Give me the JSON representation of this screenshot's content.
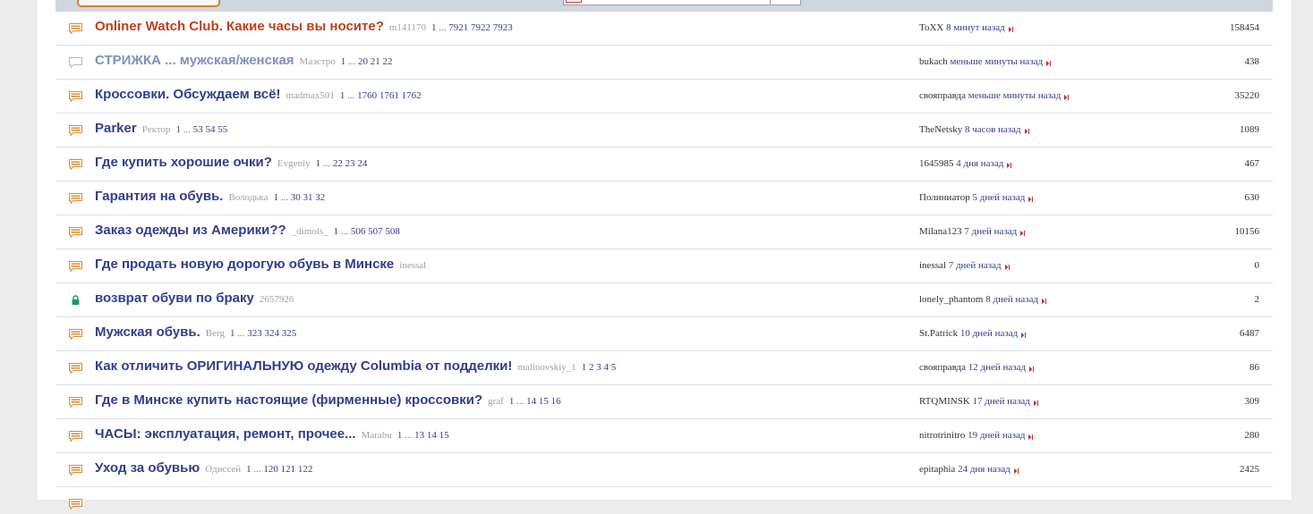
{
  "topics": [
    {
      "title": "Onliner Watch Club. Какие часы вы носите?",
      "style": "hot",
      "icon": "comment-icon",
      "author": "m141170",
      "pages": [
        "1",
        "...",
        "7921",
        "7922",
        "7923"
      ],
      "last_user": "ToXX",
      "last_time": "8 минут назад",
      "replies": "158454"
    },
    {
      "title": "СТРИЖКА ... мужская/женская",
      "style": "read",
      "icon": "comment-read-icon",
      "author": "Маэстро",
      "pages": [
        "1",
        "...",
        "20",
        "21",
        "22"
      ],
      "last_user": "bukach",
      "last_time": "меньше минуты назад",
      "replies": "438"
    },
    {
      "title": "Кроссовки. Обсуждаем всё!",
      "style": "normal",
      "icon": "comment-icon",
      "author": "madmax501",
      "pages": [
        "1",
        "...",
        "1760",
        "1761",
        "1762"
      ],
      "last_user": "свояправда",
      "last_time": "меньше минуты назад",
      "replies": "35220"
    },
    {
      "title": "Parker",
      "style": "normal",
      "icon": "comment-icon",
      "author": "Ректор",
      "pages": [
        "1",
        "...",
        "53",
        "54",
        "55"
      ],
      "last_user": "TheNetsky",
      "last_time": "8 часов назад",
      "replies": "1089"
    },
    {
      "title": "Где купить хорошие очки?",
      "style": "normal",
      "icon": "comment-icon",
      "author": "Evgeniy",
      "pages": [
        "1",
        "...",
        "22",
        "23",
        "24"
      ],
      "last_user": "1645985",
      "last_time": "4 дня назад",
      "replies": "467"
    },
    {
      "title": "Гарантия на обувь.",
      "style": "normal",
      "icon": "comment-icon",
      "author": "Володька",
      "pages": [
        "1",
        "...",
        "30",
        "31",
        "32"
      ],
      "last_user": "Полиниатор",
      "last_time": "5 дней назад",
      "replies": "630"
    },
    {
      "title": "Заказ одежды из Америки??",
      "style": "normal",
      "icon": "comment-icon",
      "author": "_dimols_",
      "pages": [
        "1",
        "...",
        "506",
        "507",
        "508"
      ],
      "last_user": "Milana123",
      "last_time": "7 дней назад",
      "replies": "10156"
    },
    {
      "title": "Где продать новую дорогую обувь в Минске",
      "style": "normal",
      "icon": "comment-icon",
      "author": "inessal",
      "pages": [],
      "last_user": "inessal",
      "last_time": "7 дней назад",
      "replies": "0"
    },
    {
      "title": "возврат обуви по браку",
      "style": "normal",
      "icon": "lock-icon",
      "author": "2657926",
      "pages": [],
      "last_user": "lonely_phantom",
      "last_time": "8 дней назад",
      "replies": "2"
    },
    {
      "title": "Мужская обувь.",
      "style": "normal",
      "icon": "comment-icon",
      "author": "Berg",
      "pages": [
        "1",
        "...",
        "323",
        "324",
        "325"
      ],
      "last_user": "St.Patrick",
      "last_time": "10 дней назад",
      "replies": "6487"
    },
    {
      "title": "Как отличить ОРИГИНАЛЬНУЮ одежду Columbia от подделки!",
      "style": "normal",
      "icon": "comment-icon",
      "author": "malinovskiy_1",
      "pages": [
        "1",
        "2",
        "3",
        "4",
        "5"
      ],
      "last_user": "свояправда",
      "last_time": "12 дней назад",
      "replies": "86"
    },
    {
      "title": "Где в Минске купить настоящие (фирменные) кроссовки?",
      "style": "normal",
      "icon": "comment-icon",
      "author": "graf",
      "pages": [
        "1",
        "...",
        "14",
        "15",
        "16"
      ],
      "last_user": "RTQMINSK",
      "last_time": "17 дней назад",
      "replies": "309"
    },
    {
      "title": "ЧАСЫ: эксплуатация, ремонт, прочее...",
      "style": "normal",
      "icon": "comment-icon",
      "author": "Marabu",
      "pages": [
        "1",
        "...",
        "13",
        "14",
        "15"
      ],
      "last_user": "nitrotrinitro",
      "last_time": "19 дней назад",
      "replies": "280"
    },
    {
      "title": "Уход за обувью",
      "style": "normal",
      "icon": "comment-icon",
      "author": "Одиссей",
      "pages": [
        "1",
        "...",
        "120",
        "121",
        "122"
      ],
      "last_user": "epitaphia",
      "last_time": "24 дня назад",
      "replies": "2425"
    }
  ],
  "colors": {
    "link": "#2e3f8f",
    "hot": "#c23d17",
    "read": "#7f8fc0",
    "icon": "#e08a2c",
    "lock": "#1a9a62",
    "jump": "#d22b2b"
  }
}
